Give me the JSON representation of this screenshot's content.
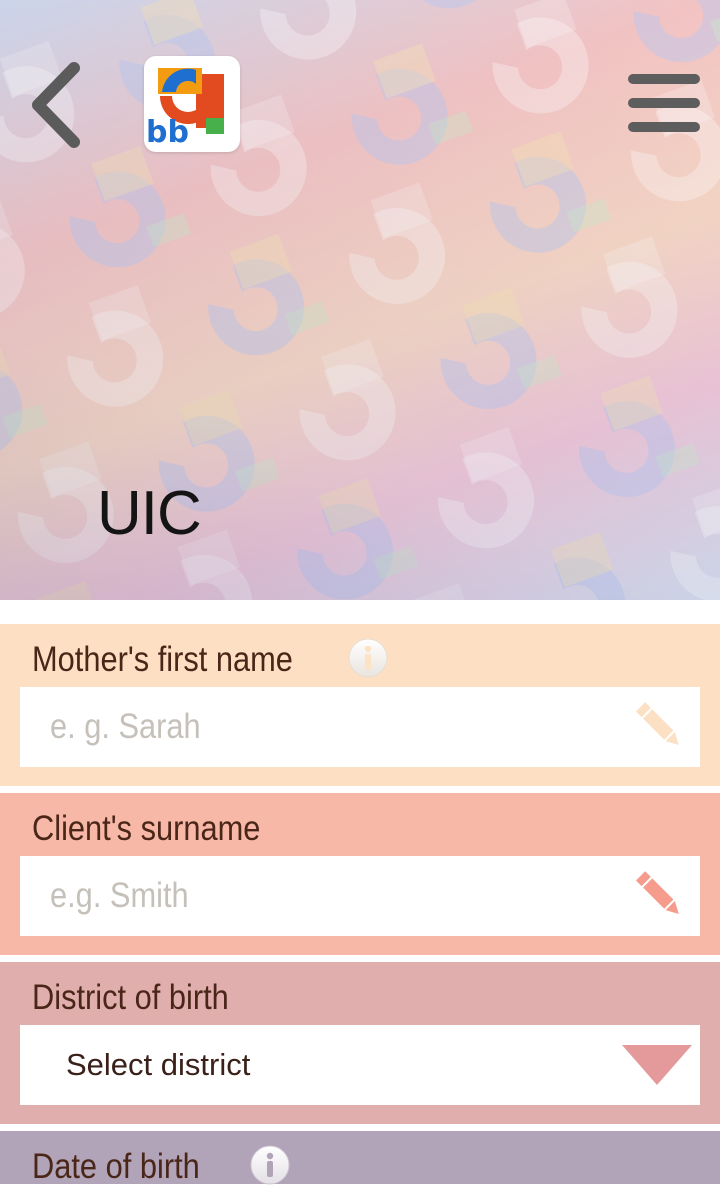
{
  "header": {
    "title": "UIC",
    "logo_text": "bb",
    "back_icon": "chevron-left-icon",
    "menu_icon": "hamburger-menu-icon"
  },
  "form": {
    "mothers_first_name": {
      "label": "Mother's first name",
      "placeholder": "e. g. Sarah",
      "icon": "info-icon",
      "bg": "#fde0c3"
    },
    "clients_surname": {
      "label": "Client's surname",
      "placeholder": "e.g. Smith",
      "bg": "#f8b8a8"
    },
    "district_of_birth": {
      "label": "District of birth",
      "selected": "Select district",
      "bg": "#e1aeae"
    },
    "date_of_birth": {
      "label": "Date of birth",
      "icon": "info-icon",
      "bg": "#b1a3b8"
    }
  },
  "colors": {
    "label_text": "#4a2619",
    "placeholder_text": "#c6c0bb",
    "pencil_light": "#fbe0c4",
    "pencil_salmon": "#f59c8c",
    "dropdown_caret": "#e49a9a"
  }
}
